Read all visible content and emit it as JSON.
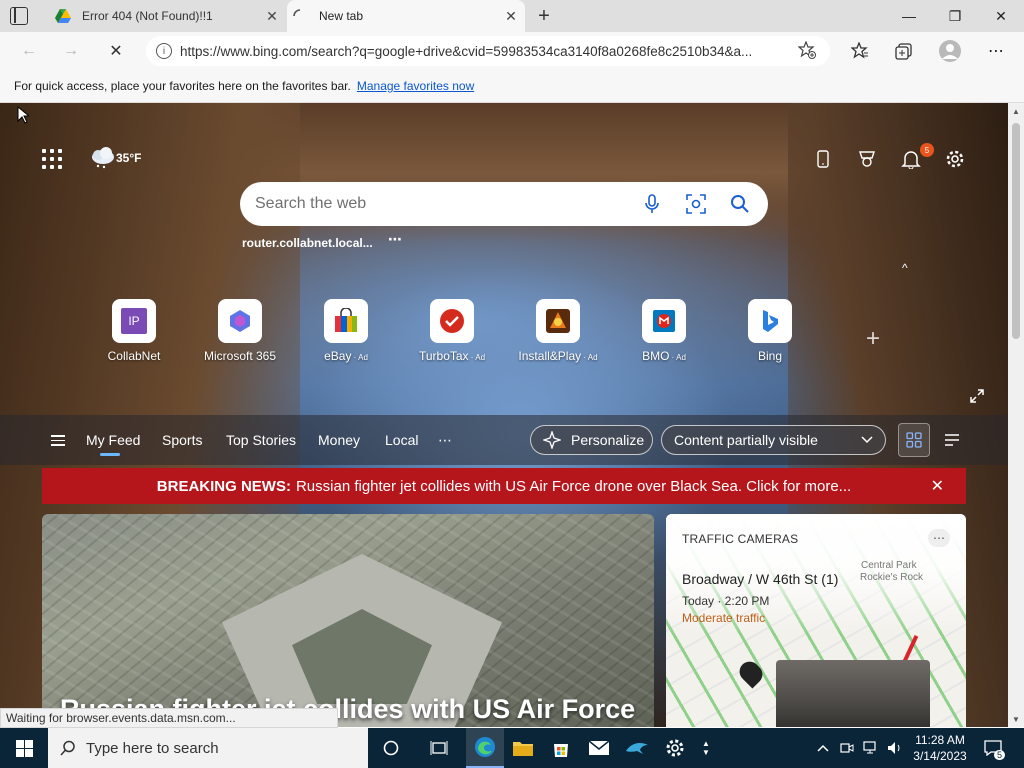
{
  "tabs": [
    {
      "title": "Error 404 (Not Found)!!1",
      "close": "✕"
    },
    {
      "title": "New tab",
      "close": "✕"
    }
  ],
  "window_controls": {
    "minimize": "—",
    "maximize": "❐",
    "close": "✕",
    "new_tab": "+"
  },
  "toolbar": {
    "url": "https://www.bing.com/search?q=google+drive&cvid=59983534ca3140f8a0268fe8c2510b34&a...",
    "back": "←",
    "forward": "→",
    "stop": "✕",
    "more": "⋯"
  },
  "favorites_bar": {
    "message": "For quick access, place your favorites here on the favorites bar.",
    "link": "Manage favorites now"
  },
  "newtab": {
    "weather": "35°F",
    "notification_count": "5",
    "search_placeholder": "Search the web",
    "recent_search": "router.collabnet.local...",
    "recent_more": "⋯",
    "collapse": "^",
    "add_site": "+",
    "tiles": [
      {
        "label": "CollabNet",
        "ad": ""
      },
      {
        "label": "Microsoft 365",
        "ad": ""
      },
      {
        "label": "eBay",
        "ad": " · Ad"
      },
      {
        "label": "TurboTax",
        "ad": " · Ad"
      },
      {
        "label": "Install&Play",
        "ad": " · Ad"
      },
      {
        "label": "BMO",
        "ad": " · Ad"
      },
      {
        "label": "Bing",
        "ad": ""
      }
    ],
    "tile_icons": {
      "collabnet": "IP"
    }
  },
  "feed": {
    "tabs": [
      "My Feed",
      "Sports",
      "Top Stories",
      "Money",
      "Local"
    ],
    "more": "⋯",
    "personalize": "Personalize",
    "content_visibility": "Content partially visible",
    "breaking_label": "BREAKING NEWS:",
    "breaking_text": "Russian fighter jet collides with US Air Force drone over Black Sea. Click for more...",
    "breaking_close": "✕",
    "headline": "Russian fighter jet collides with US Air Force",
    "traffic": {
      "title": "TRAFFIC CAMERAS",
      "more": "⋯",
      "location": "Broadway / W 46th St (1)",
      "time": "Today · 2:20 PM",
      "status": "Moderate traffic",
      "map_label_1": "Central Park",
      "map_label_2": "Rockie's Rock"
    }
  },
  "status_bar": "Waiting for browser.events.data.msn.com...",
  "taskbar": {
    "search_placeholder": "Type here to search",
    "time": "11:28 AM",
    "date": "3/14/2023",
    "notification_count": "5"
  },
  "colors": {
    "accent": "#0b57d0",
    "breaking": "#b5161c",
    "taskbar": "#0a2438"
  }
}
